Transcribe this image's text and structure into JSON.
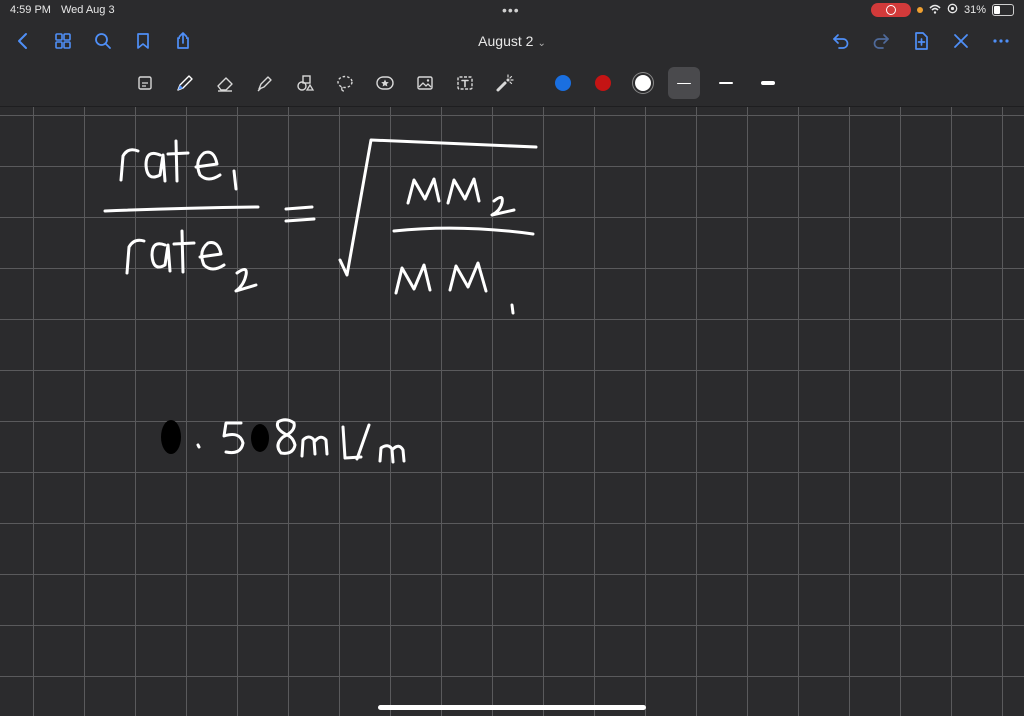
{
  "status_bar": {
    "time": "4:59 PM",
    "date": "Wed Aug 3",
    "battery": "31%",
    "battery_level": 0.31
  },
  "nav": {
    "title": "August 2",
    "title_chevron": "⌄",
    "left_icons": [
      "back-chevron-icon",
      "grid-icon",
      "search-icon",
      "bookmark-icon",
      "share-icon"
    ],
    "right_icons": [
      "undo-icon",
      "redo-icon",
      "add-page-icon",
      "close-icon",
      "more-icon"
    ]
  },
  "toolbar": {
    "tools": [
      "read-mode-icon",
      "pen-icon",
      "eraser-icon",
      "highlighter-icon",
      "shapes-icon",
      "lasso-icon",
      "sticker-icon",
      "image-icon",
      "text-icon",
      "laser-pointer-icon"
    ],
    "active_tool": "pen-icon",
    "colors": [
      "#1a6fe0",
      "#c41414",
      "#ffffff"
    ],
    "selected_color": "#ffffff",
    "stroke_sizes": [
      "thin",
      "medium",
      "thick"
    ],
    "selected_stroke": "thin"
  },
  "note": {
    "ink_color": "#ffffff",
    "grid_color": "#5a5a5c",
    "background_color": "#2b2b2d"
  }
}
